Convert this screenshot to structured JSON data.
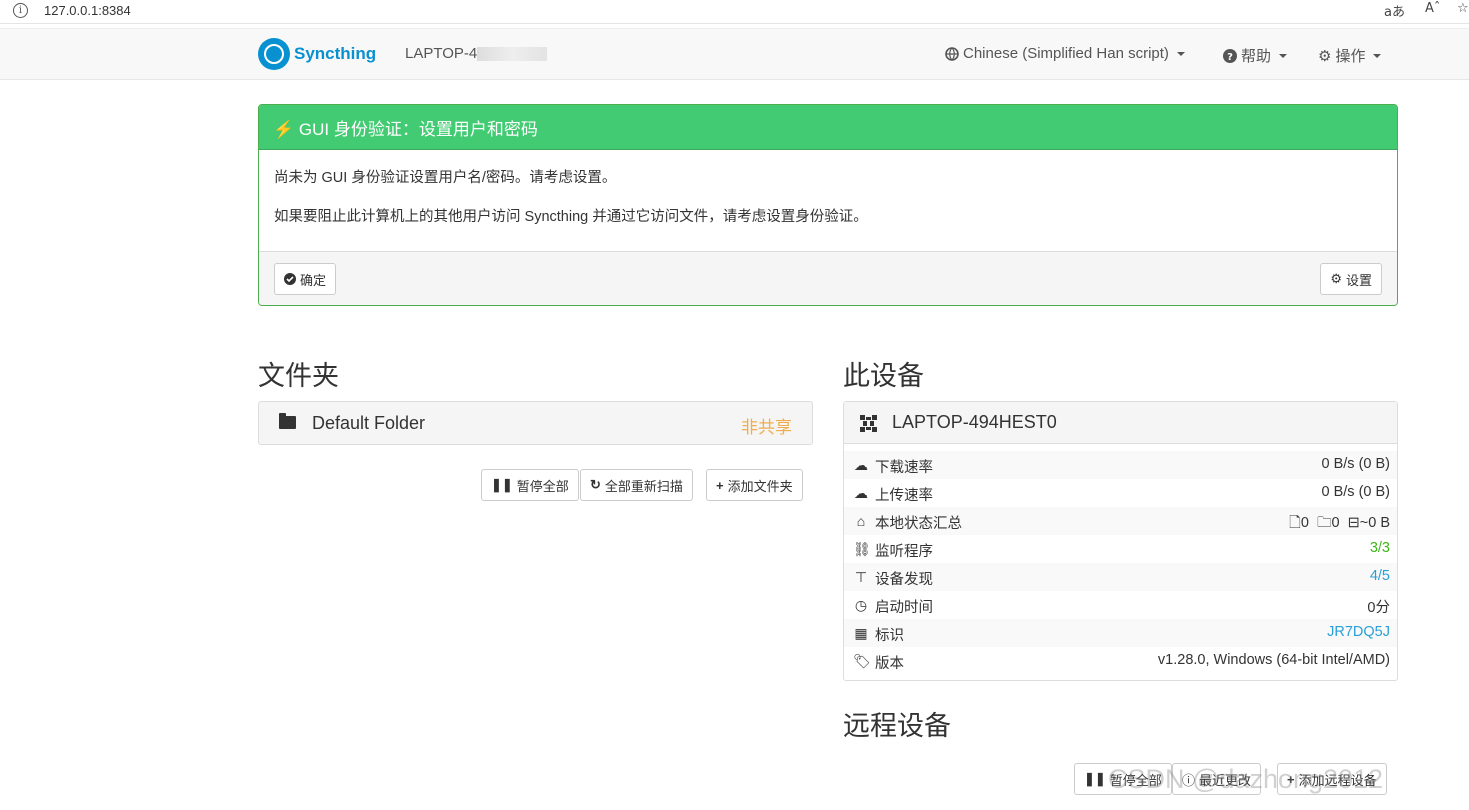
{
  "browser": {
    "url": "127.0.0.1:8384",
    "tools": [
      "aあ",
      "Aˆ",
      "☆"
    ]
  },
  "navbar": {
    "brand": "Syncthing",
    "hostname_prefix": "LAPTOP-4",
    "language": "Chinese (Simplified Han script)",
    "help": "帮助",
    "actions": "操作"
  },
  "alert": {
    "title": "GUI 身份验证：设置用户和密码",
    "line1": "尚未为 GUI 身份验证设置用户名/密码。请考虑设置。",
    "line2": "如果要阻止此计算机上的其他用户访问 Syncthing 并通过它访问文件，请考虑设置身份验证。",
    "ok_button": "确定",
    "settings_button": "设置"
  },
  "folders": {
    "heading": "文件夹",
    "items": [
      {
        "name": "Default Folder",
        "status": "非共享"
      }
    ],
    "buttons": {
      "pause_all": "暂停全部",
      "rescan_all": "全部重新扫描",
      "add_folder": "添加文件夹"
    }
  },
  "this_device": {
    "heading": "此设备",
    "name": "LAPTOP-494HEST0",
    "rows": [
      {
        "icon": "cloud-download-icon",
        "label": "下载速率",
        "value": "0 B/s (0 B)"
      },
      {
        "icon": "cloud-upload-icon",
        "label": "上传速率",
        "value": "0 B/s (0 B)"
      },
      {
        "icon": "home-icon",
        "label": "本地状态汇总",
        "files": "0",
        "dirs": "0",
        "size": "~0 B"
      },
      {
        "icon": "sitemap-icon",
        "label": "监听程序",
        "value": "3/3"
      },
      {
        "icon": "signpost-icon",
        "label": "设备发现",
        "value": "4/5"
      },
      {
        "icon": "clock-icon",
        "label": "启动时间",
        "value": "0分"
      },
      {
        "icon": "qrcode-icon",
        "label": "标识",
        "value": "JR7DQ5J"
      },
      {
        "icon": "tag-icon",
        "label": "版本",
        "value": "v1.28.0, Windows (64-bit Intel/AMD)"
      }
    ]
  },
  "remote_devices": {
    "heading": "远程设备",
    "buttons": {
      "pause_all": "暂停全部",
      "recent_changes": "最近更改",
      "add_device": "添加远程设备"
    }
  },
  "watermark": "CSDN @dazhong2012",
  "colors": {
    "success": "#42cb72",
    "brand": "#0891d1",
    "warning": "#f0ad4e",
    "green": "#3fb618",
    "blue": "#2a9fd6"
  }
}
